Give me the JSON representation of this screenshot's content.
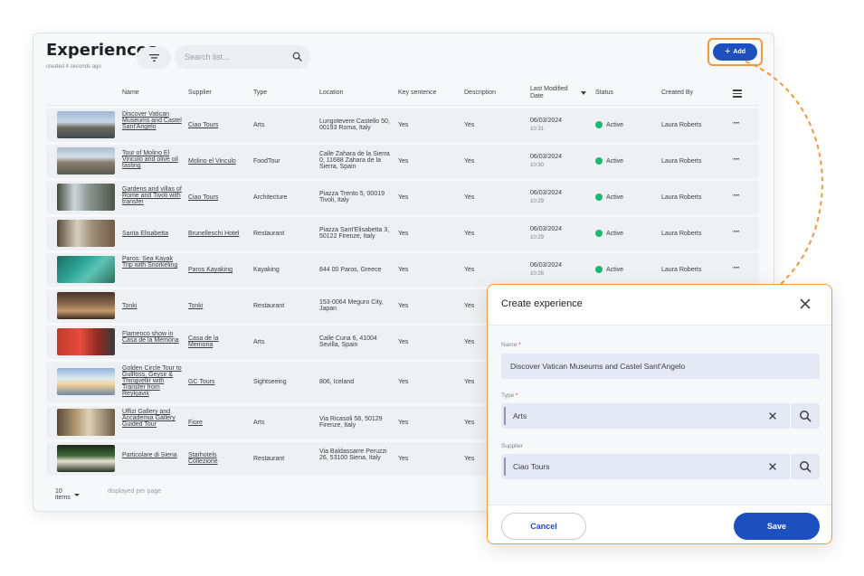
{
  "header": {
    "title": "Experiences",
    "subtitle": "created 4 seconds ago",
    "search_placeholder": "Search list...",
    "add_label": "Add"
  },
  "columns": {
    "name": "Name",
    "supplier": "Supplier",
    "type": "Type",
    "location": "Location",
    "key_sentence": "Key sentence",
    "description": "Description",
    "last_modified": "Last Modified Date",
    "status": "Status",
    "created_by": "Created By"
  },
  "rows": [
    {
      "name": "Discover Vatican Museums and Castel Sant'Angelo",
      "supplier": "Ciao Tours",
      "type": "Arts",
      "location": "Lungotevere Castello 50, 00193 Roma, Italy",
      "key_sentence": "Yes",
      "description": "Yes",
      "date": "06/03/2024",
      "time": "10:31",
      "status": "Active",
      "created_by": "Laura Roberts"
    },
    {
      "name": "Tour of Molino El Vinculo and olive oil tasting",
      "supplier": "Molino el Vinculo",
      "type": "FoodTour",
      "location": "Calle Zahara de la Sierra 0, 11688 Zahara de la Sierra, Spain",
      "key_sentence": "Yes",
      "description": "Yes",
      "date": "06/03/2024",
      "time": "10:30",
      "status": "Active",
      "created_by": "Laura Roberts"
    },
    {
      "name": "Gardens and villas of Rome and Tivoli with transfer",
      "supplier": "Ciao Tours",
      "type": "Architecture",
      "location": "Piazza Trento 5, 00019 Tivoli, Italy",
      "key_sentence": "Yes",
      "description": "Yes",
      "date": "06/03/2024",
      "time": "10:29",
      "status": "Active",
      "created_by": "Laura Roberts"
    },
    {
      "name": "Santa Elisabetta",
      "supplier": "Brunelleschi Hotel",
      "type": "Restaurant",
      "location": "Piazza Sant'Elisabetta 3, 50122 Firenze, Italy",
      "key_sentence": "Yes",
      "description": "Yes",
      "date": "06/03/2024",
      "time": "10:29",
      "status": "Active",
      "created_by": "Laura Roberts"
    },
    {
      "name": "Paros: Sea Kayak Trip with Snorkeling",
      "supplier": "Paros Kayaking",
      "type": "Kayaking",
      "location": "844 00 Paros, Greece",
      "key_sentence": "Yes",
      "description": "Yes",
      "date": "06/03/2024",
      "time": "10:28",
      "status": "Active",
      "created_by": "Laura Roberts"
    },
    {
      "name": "Tonki",
      "supplier": "Tonki",
      "type": "Restaurant",
      "location": "153-0064 Meguro City, Japan",
      "key_sentence": "Yes",
      "description": "Yes",
      "date": "",
      "time": "",
      "status": "",
      "created_by": ""
    },
    {
      "name": "Flamenco show in Casa de la Memoria",
      "supplier": "Casa de la Memoria",
      "type": "Arts",
      "location": "Calle Cuna 6, 41004 Sevilla, Spain",
      "key_sentence": "Yes",
      "description": "Yes",
      "date": "",
      "time": "",
      "status": "",
      "created_by": ""
    },
    {
      "name": "Golden Circle Tour to Gullfoss, Geysir & Thingvellir with Transfer from Reykjavik",
      "supplier": "GC Tours",
      "type": "Sightseeing",
      "location": "806, Iceland",
      "key_sentence": "Yes",
      "description": "Yes",
      "date": "",
      "time": "",
      "status": "",
      "created_by": ""
    },
    {
      "name": "Uffizi Gallery and Accademia Gallery Guided Tour",
      "supplier": "Fiore",
      "type": "Arts",
      "location": "Via Ricasoli 58, 50129 Firenze, Italy",
      "key_sentence": "Yes",
      "description": "Yes",
      "date": "",
      "time": "",
      "status": "",
      "created_by": ""
    },
    {
      "name": "Particolare di Siena",
      "supplier": "Starhotels Collezione",
      "type": "Restaurant",
      "location": "Via Baldassarre Peruzzi 26, 53100 Siena, Italy",
      "key_sentence": "Yes",
      "description": "Yes",
      "date": "",
      "time": "",
      "status": "",
      "created_by": ""
    }
  ],
  "footer": {
    "items_label": "10 items",
    "per_page_label": "displayed per page"
  },
  "modal": {
    "title": "Create experience",
    "name_label": "Name",
    "name_value": "Discover Vatican Museums and Castel Sant'Angelo",
    "type_label": "Type",
    "type_value": "Arts",
    "supplier_label": "Supplier",
    "supplier_value": "Ciao Tours",
    "required_mark": "*",
    "cancel_label": "Cancel",
    "save_label": "Save"
  },
  "colors": {
    "accent": "#1e4fbf",
    "highlight": "#f09a3e",
    "active": "#1eb86e"
  }
}
